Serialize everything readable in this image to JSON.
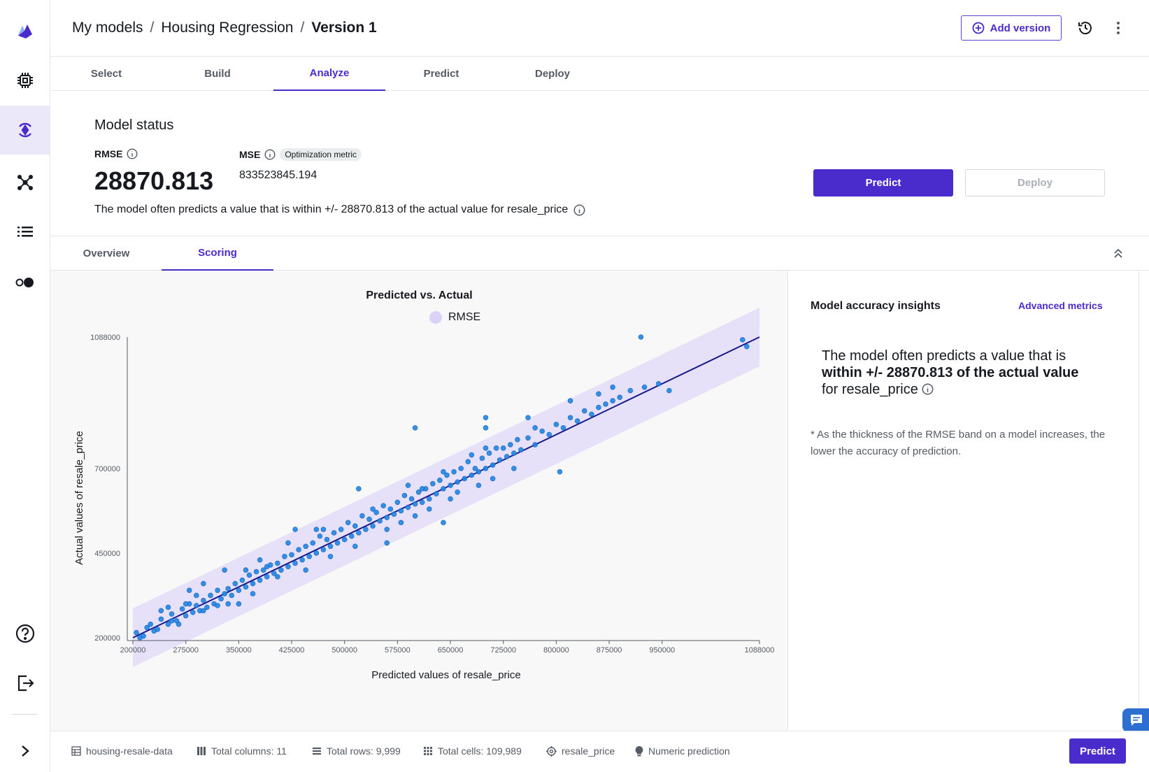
{
  "breadcrumb": {
    "item1": "My models",
    "item2": "Housing Regression",
    "current": "Version 1",
    "separator": "/"
  },
  "header": {
    "add_version_label": "Add version"
  },
  "steps": [
    "Select",
    "Build",
    "Analyze",
    "Predict",
    "Deploy"
  ],
  "status": {
    "title": "Model status",
    "rmse_label": "RMSE",
    "rmse_value": "28870.813",
    "mse_label": "MSE",
    "mse_badge": "Optimization metric",
    "mse_value": "833523845.194",
    "description": "The model often predicts a value that is within +/- 28870.813 of the actual value for resale_price",
    "predict_label": "Predict",
    "deploy_label": "Deploy"
  },
  "subtabs": [
    "Overview",
    "Scoring"
  ],
  "insights": {
    "title": "Model accuracy insights",
    "advanced_link": "Advanced metrics",
    "big_pre": "The model often predicts a value that is",
    "big_bold": "within +/- 28870.813 of the actual value",
    "big_post": "for resale_price",
    "note": "* As the thickness of the RMSE band on a model increases, the lower the accuracy of prediction."
  },
  "footer": {
    "dataset": "housing-resale-data",
    "columns": "Total columns: 11",
    "rows": "Total rows: 9,999",
    "cells": "Total cells: 109,989",
    "target": "resale_price",
    "problem": "Numeric prediction",
    "predict_label": "Predict"
  },
  "colors": {
    "accent": "#4a2ccc",
    "point": "#1f87e5",
    "band": "#dcd2f7",
    "line": "#1a1a8c"
  },
  "chart_data": {
    "type": "scatter",
    "title": "Predicted vs. Actual",
    "legend": [
      "RMSE"
    ],
    "xlabel": "Predicted values of resale_price",
    "ylabel": "Actual values of resale_price",
    "x_ticks": [
      200000,
      275000,
      350000,
      425000,
      500000,
      575000,
      650000,
      725000,
      800000,
      875000,
      950000,
      1088000
    ],
    "y_ticks": [
      200000,
      450000,
      700000,
      1088000
    ],
    "xlim": [
      200000,
      1088000
    ],
    "ylim": [
      200000,
      1088000
    ],
    "rmse": 28870.813,
    "points": [
      [
        205000,
        215000
      ],
      [
        210000,
        200000
      ],
      [
        220000,
        230000
      ],
      [
        235000,
        225000
      ],
      [
        240000,
        255000
      ],
      [
        250000,
        240000
      ],
      [
        255000,
        270000
      ],
      [
        262000,
        250000
      ],
      [
        270000,
        285000
      ],
      [
        275000,
        265000
      ],
      [
        280000,
        300000
      ],
      [
        285000,
        275000
      ],
      [
        290000,
        295000
      ],
      [
        295000,
        280000
      ],
      [
        300000,
        310000
      ],
      [
        305000,
        290000
      ],
      [
        310000,
        325000
      ],
      [
        315000,
        300000
      ],
      [
        320000,
        340000
      ],
      [
        325000,
        315000
      ],
      [
        330000,
        330000
      ],
      [
        335000,
        345000
      ],
      [
        340000,
        325000
      ],
      [
        345000,
        360000
      ],
      [
        350000,
        340000
      ],
      [
        355000,
        370000
      ],
      [
        360000,
        350000
      ],
      [
        365000,
        385000
      ],
      [
        370000,
        360000
      ],
      [
        375000,
        395000
      ],
      [
        380000,
        370000
      ],
      [
        385000,
        400000
      ],
      [
        390000,
        380000
      ],
      [
        395000,
        415000
      ],
      [
        400000,
        390000
      ],
      [
        405000,
        420000
      ],
      [
        410000,
        400000
      ],
      [
        415000,
        440000
      ],
      [
        420000,
        410000
      ],
      [
        425000,
        445000
      ],
      [
        430000,
        420000
      ],
      [
        435000,
        460000
      ],
      [
        440000,
        430000
      ],
      [
        445000,
        470000
      ],
      [
        450000,
        440000
      ],
      [
        455000,
        480000
      ],
      [
        460000,
        450000
      ],
      [
        465000,
        500000
      ],
      [
        470000,
        460000
      ],
      [
        475000,
        490000
      ],
      [
        480000,
        470000
      ],
      [
        485000,
        510000
      ],
      [
        490000,
        480000
      ],
      [
        495000,
        520000
      ],
      [
        500000,
        490000
      ],
      [
        505000,
        540000
      ],
      [
        510000,
        500000
      ],
      [
        515000,
        530000
      ],
      [
        520000,
        510000
      ],
      [
        525000,
        560000
      ],
      [
        530000,
        520000
      ],
      [
        535000,
        550000
      ],
      [
        540000,
        530000
      ],
      [
        545000,
        570000
      ],
      [
        550000,
        545000
      ],
      [
        555000,
        590000
      ],
      [
        560000,
        555000
      ],
      [
        565000,
        580000
      ],
      [
        570000,
        565000
      ],
      [
        575000,
        600000
      ],
      [
        580000,
        575000
      ],
      [
        585000,
        620000
      ],
      [
        590000,
        585000
      ],
      [
        595000,
        610000
      ],
      [
        600000,
        595000
      ],
      [
        605000,
        630000
      ],
      [
        610000,
        600000
      ],
      [
        615000,
        640000
      ],
      [
        620000,
        610000
      ],
      [
        625000,
        655000
      ],
      [
        630000,
        625000
      ],
      [
        635000,
        665000
      ],
      [
        640000,
        640000
      ],
      [
        645000,
        680000
      ],
      [
        650000,
        650000
      ],
      [
        655000,
        690000
      ],
      [
        660000,
        660000
      ],
      [
        665000,
        700000
      ],
      [
        670000,
        670000
      ],
      [
        675000,
        720000
      ],
      [
        680000,
        680000
      ],
      [
        685000,
        700000
      ],
      [
        690000,
        690000
      ],
      [
        695000,
        730000
      ],
      [
        700000,
        700000
      ],
      [
        705000,
        745000
      ],
      [
        710000,
        710000
      ],
      [
        715000,
        760000
      ],
      [
        720000,
        725000
      ],
      [
        725000,
        760000
      ],
      [
        730000,
        735000
      ],
      [
        735000,
        770000
      ],
      [
        740000,
        745000
      ],
      [
        745000,
        785000
      ],
      [
        750000,
        755000
      ],
      [
        760000,
        790000
      ],
      [
        770000,
        770000
      ],
      [
        780000,
        810000
      ],
      [
        790000,
        800000
      ],
      [
        800000,
        830000
      ],
      [
        810000,
        820000
      ],
      [
        820000,
        850000
      ],
      [
        830000,
        840000
      ],
      [
        840000,
        870000
      ],
      [
        850000,
        860000
      ],
      [
        860000,
        880000
      ],
      [
        870000,
        890000
      ],
      [
        880000,
        900000
      ],
      [
        890000,
        910000
      ],
      [
        905000,
        930000
      ],
      [
        925000,
        940000
      ],
      [
        945000,
        950000
      ],
      [
        960000,
        930000
      ],
      [
        920000,
        1088000
      ],
      [
        1064000,
        1080000
      ],
      [
        1070000,
        1060000
      ],
      [
        600000,
        820000
      ],
      [
        700000,
        820000
      ],
      [
        640000,
        540000
      ],
      [
        560000,
        480000
      ],
      [
        520000,
        640000
      ],
      [
        480000,
        440000
      ],
      [
        430000,
        520000
      ],
      [
        380000,
        430000
      ],
      [
        330000,
        400000
      ],
      [
        300000,
        360000
      ],
      [
        280000,
        340000
      ],
      [
        250000,
        290000
      ],
      [
        240000,
        280000
      ],
      [
        700000,
        850000
      ],
      [
        760000,
        850000
      ],
      [
        805000,
        690000
      ],
      [
        710000,
        670000
      ],
      [
        680000,
        740000
      ],
      [
        740000,
        700000
      ],
      [
        600000,
        560000
      ],
      [
        650000,
        610000
      ],
      [
        610000,
        640000
      ],
      [
        460000,
        520000
      ],
      [
        420000,
        480000
      ],
      [
        390000,
        410000
      ],
      [
        360000,
        400000
      ],
      [
        335000,
        300000
      ],
      [
        290000,
        325000
      ],
      [
        265000,
        240000
      ],
      [
        230000,
        220000
      ],
      [
        540000,
        580000
      ],
      [
        580000,
        540000
      ],
      [
        620000,
        580000
      ],
      [
        660000,
        630000
      ],
      [
        700000,
        760000
      ],
      [
        770000,
        820000
      ],
      [
        820000,
        900000
      ],
      [
        860000,
        920000
      ],
      [
        880000,
        940000
      ],
      [
        690000,
        650000
      ],
      [
        640000,
        690000
      ],
      [
        590000,
        650000
      ],
      [
        560000,
        520000
      ],
      [
        515000,
        470000
      ],
      [
        470000,
        520000
      ],
      [
        445000,
        400000
      ],
      [
        405000,
        380000
      ],
      [
        370000,
        330000
      ],
      [
        350000,
        300000
      ],
      [
        320000,
        295000
      ],
      [
        300000,
        280000
      ],
      [
        275000,
        300000
      ],
      [
        255000,
        250000
      ],
      [
        225000,
        240000
      ],
      [
        215000,
        205000
      ]
    ]
  }
}
